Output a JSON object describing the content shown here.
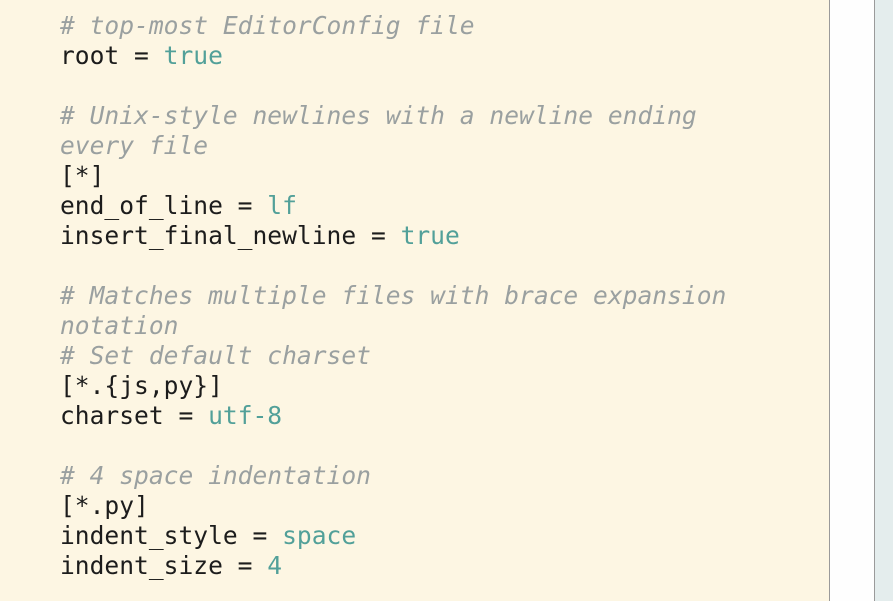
{
  "document": {
    "language": "editorconfig",
    "background_color": "#fdf6e3",
    "comment_color": "#9aa0a0",
    "text_color": "#1c1c1c",
    "value_color": "#52a099",
    "side_panel_color": "#e4eded",
    "scrollbar_track_color": "#fefefe",
    "scrollbar_border_color": "#9a9a9a"
  },
  "code": {
    "lines": [
      {
        "id": "l1",
        "type": "comment",
        "text": "# top-most EditorConfig file"
      },
      {
        "id": "l2",
        "type": "pair",
        "key": "root",
        "op": " = ",
        "value": "true"
      },
      {
        "id": "l3",
        "type": "blank",
        "text": ""
      },
      {
        "id": "l4",
        "type": "comment",
        "text": "# Unix-style newlines with a newline ending"
      },
      {
        "id": "l5",
        "type": "comment",
        "text": "every file"
      },
      {
        "id": "l6",
        "type": "section",
        "text": "[*]"
      },
      {
        "id": "l7",
        "type": "pair",
        "key": "end_of_line",
        "op": " = ",
        "value": "lf"
      },
      {
        "id": "l8",
        "type": "pair",
        "key": "insert_final_newline",
        "op": " = ",
        "value": "true"
      },
      {
        "id": "l9",
        "type": "blank",
        "text": ""
      },
      {
        "id": "l10",
        "type": "comment",
        "text": "# Matches multiple files with brace expansion"
      },
      {
        "id": "l11",
        "type": "comment",
        "text": "notation"
      },
      {
        "id": "l12",
        "type": "comment",
        "text": "# Set default charset"
      },
      {
        "id": "l13",
        "type": "section",
        "text": "[*.{js,py}]"
      },
      {
        "id": "l14",
        "type": "pair",
        "key": "charset",
        "op": " = ",
        "value": "utf-8"
      },
      {
        "id": "l15",
        "type": "blank",
        "text": ""
      },
      {
        "id": "l16",
        "type": "comment",
        "text": "# 4 space indentation"
      },
      {
        "id": "l17",
        "type": "section",
        "text": "[*.py]"
      },
      {
        "id": "l18",
        "type": "pair",
        "key": "indent_style",
        "op": " = ",
        "value": "space"
      },
      {
        "id": "l19",
        "type": "pair",
        "key": "indent_size",
        "op": " = ",
        "value": "4"
      }
    ]
  }
}
